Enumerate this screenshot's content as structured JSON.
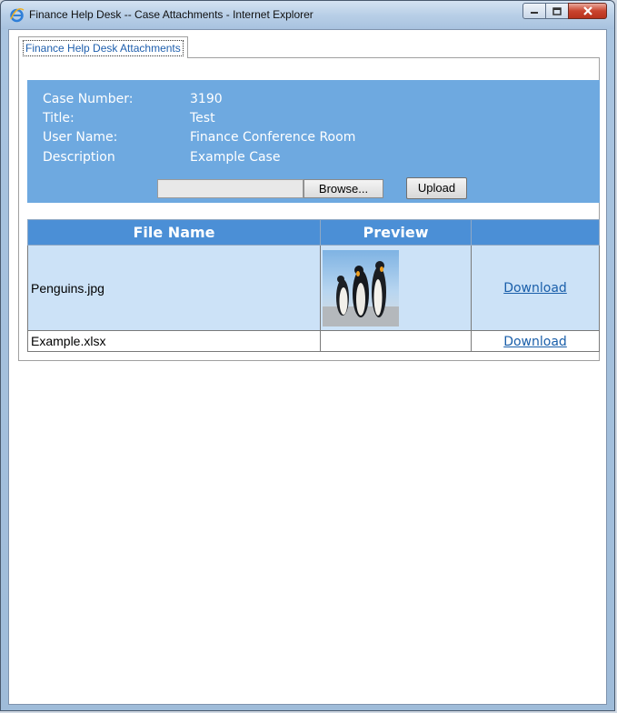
{
  "window": {
    "title": "Finance Help Desk -- Case Attachments - Internet Explorer",
    "app_icon": "ie-icon"
  },
  "tab": {
    "label": "Finance Help Desk Attachments"
  },
  "case_info": {
    "fields": [
      {
        "label": "Case Number:",
        "value": "3190"
      },
      {
        "label": "Title:",
        "value": "Test"
      },
      {
        "label": "User Name:",
        "value": "Finance Conference Room"
      },
      {
        "label": "Description",
        "value": "Example Case"
      }
    ]
  },
  "upload": {
    "file_path": "",
    "browse_label": "Browse...",
    "upload_label": "Upload"
  },
  "files_table": {
    "headers": [
      "File Name",
      "Preview",
      ""
    ],
    "rows": [
      {
        "file_name": "Penguins.jpg",
        "has_preview": true,
        "action": "Download"
      },
      {
        "file_name": "Example.xlsx",
        "has_preview": false,
        "action": "Download"
      }
    ]
  },
  "colors": {
    "info_bg": "#6ea9e0",
    "header_bg": "#4b8fd6",
    "alt_row_bg": "#cce2f7",
    "link": "#1a5faa"
  }
}
